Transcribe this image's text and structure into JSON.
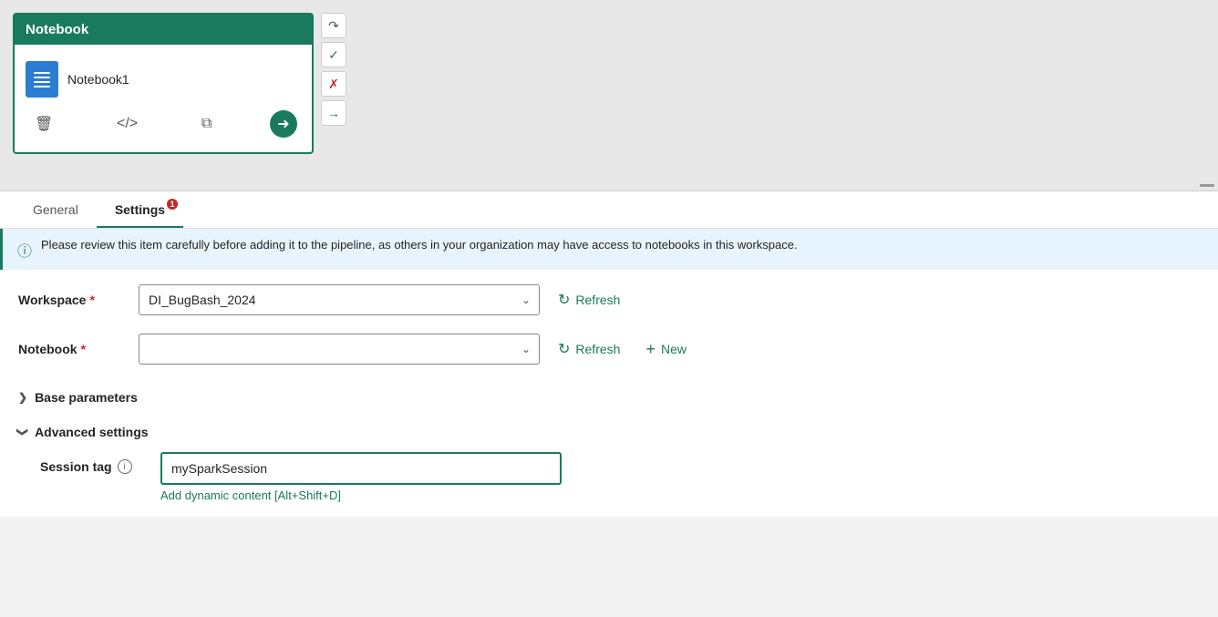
{
  "canvas": {
    "notebook_card": {
      "header": "Notebook",
      "item_name": "Notebook1"
    },
    "side_toolbar": {
      "redo_icon": "↷",
      "check_icon": "✔",
      "cross_icon": "✖",
      "arrow_right_icon": "→"
    }
  },
  "tabs": {
    "general": "General",
    "settings": "Settings",
    "settings_badge": "1"
  },
  "info_banner": {
    "text": "Please review this item carefully before adding it to the pipeline, as others in your organization may have access to notebooks in this workspace."
  },
  "form": {
    "workspace_label": "Workspace",
    "workspace_required": "*",
    "workspace_value": "DI_BugBash_2024",
    "notebook_label": "Notebook",
    "notebook_required": "*",
    "notebook_value": "",
    "notebook_placeholder": "",
    "refresh_label": "Refresh",
    "new_label": "New",
    "base_params_label": "Base parameters",
    "advanced_settings_label": "Advanced settings",
    "session_tag_label": "Session tag",
    "session_tag_value": "mySparkSession",
    "dynamic_content_link": "Add dynamic content [Alt+Shift+D]"
  },
  "icons": {
    "trash": "🗑",
    "code": "</>",
    "copy": "⧉",
    "refresh_circle": "↺",
    "plus": "+",
    "chevron_right": "›",
    "chevron_down": "∨",
    "info_i": "i"
  }
}
